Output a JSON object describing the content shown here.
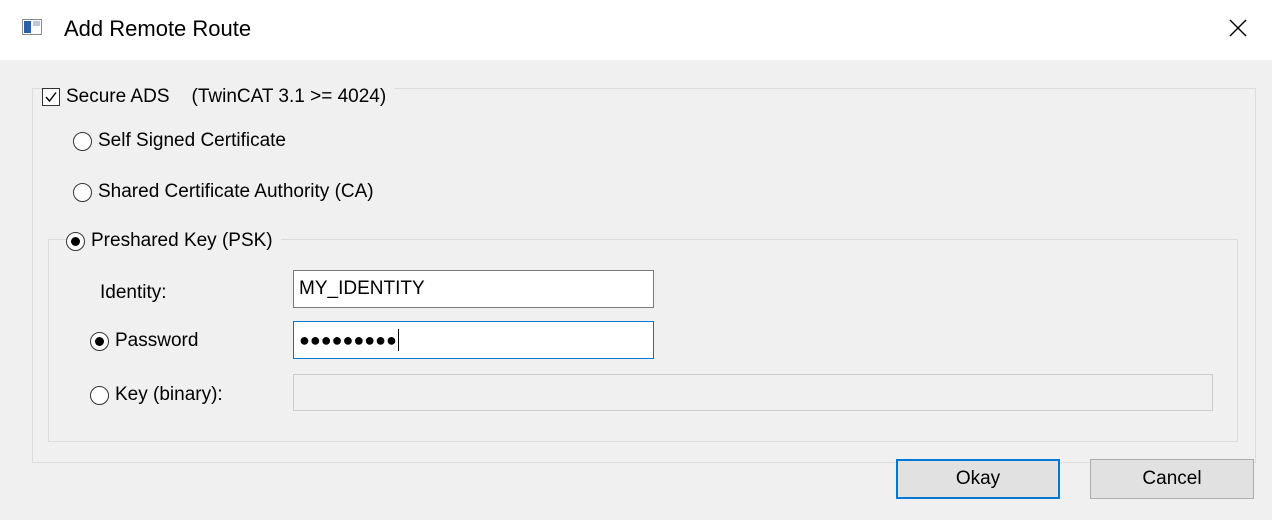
{
  "window": {
    "title": "Add Remote Route",
    "icon": "app-window-icon",
    "close_icon": "close-icon"
  },
  "secure_ads": {
    "label": "Secure ADS",
    "version_note": "(TwinCAT 3.1 >= 4024)",
    "checked": true
  },
  "options": {
    "self_signed": {
      "label": "Self Signed Certificate",
      "selected": false
    },
    "shared_ca": {
      "label": "Shared Certificate Authority (CA)",
      "selected": false
    },
    "psk": {
      "label": "Preshared Key (PSK)",
      "selected": true
    }
  },
  "psk_group": {
    "identity_label": "Identity:",
    "identity_value": "MY_IDENTITY",
    "password_label": "Password",
    "password_selected": true,
    "password_mask": "●●●●●●●●●",
    "key_label": "Key (binary):",
    "key_selected": false,
    "key_value": ""
  },
  "buttons": {
    "okay": "Okay",
    "cancel": "Cancel"
  },
  "colors": {
    "accent": "#0078d7",
    "dialog_background": "#f0f0f0",
    "titlebar_background": "#ffffff"
  }
}
